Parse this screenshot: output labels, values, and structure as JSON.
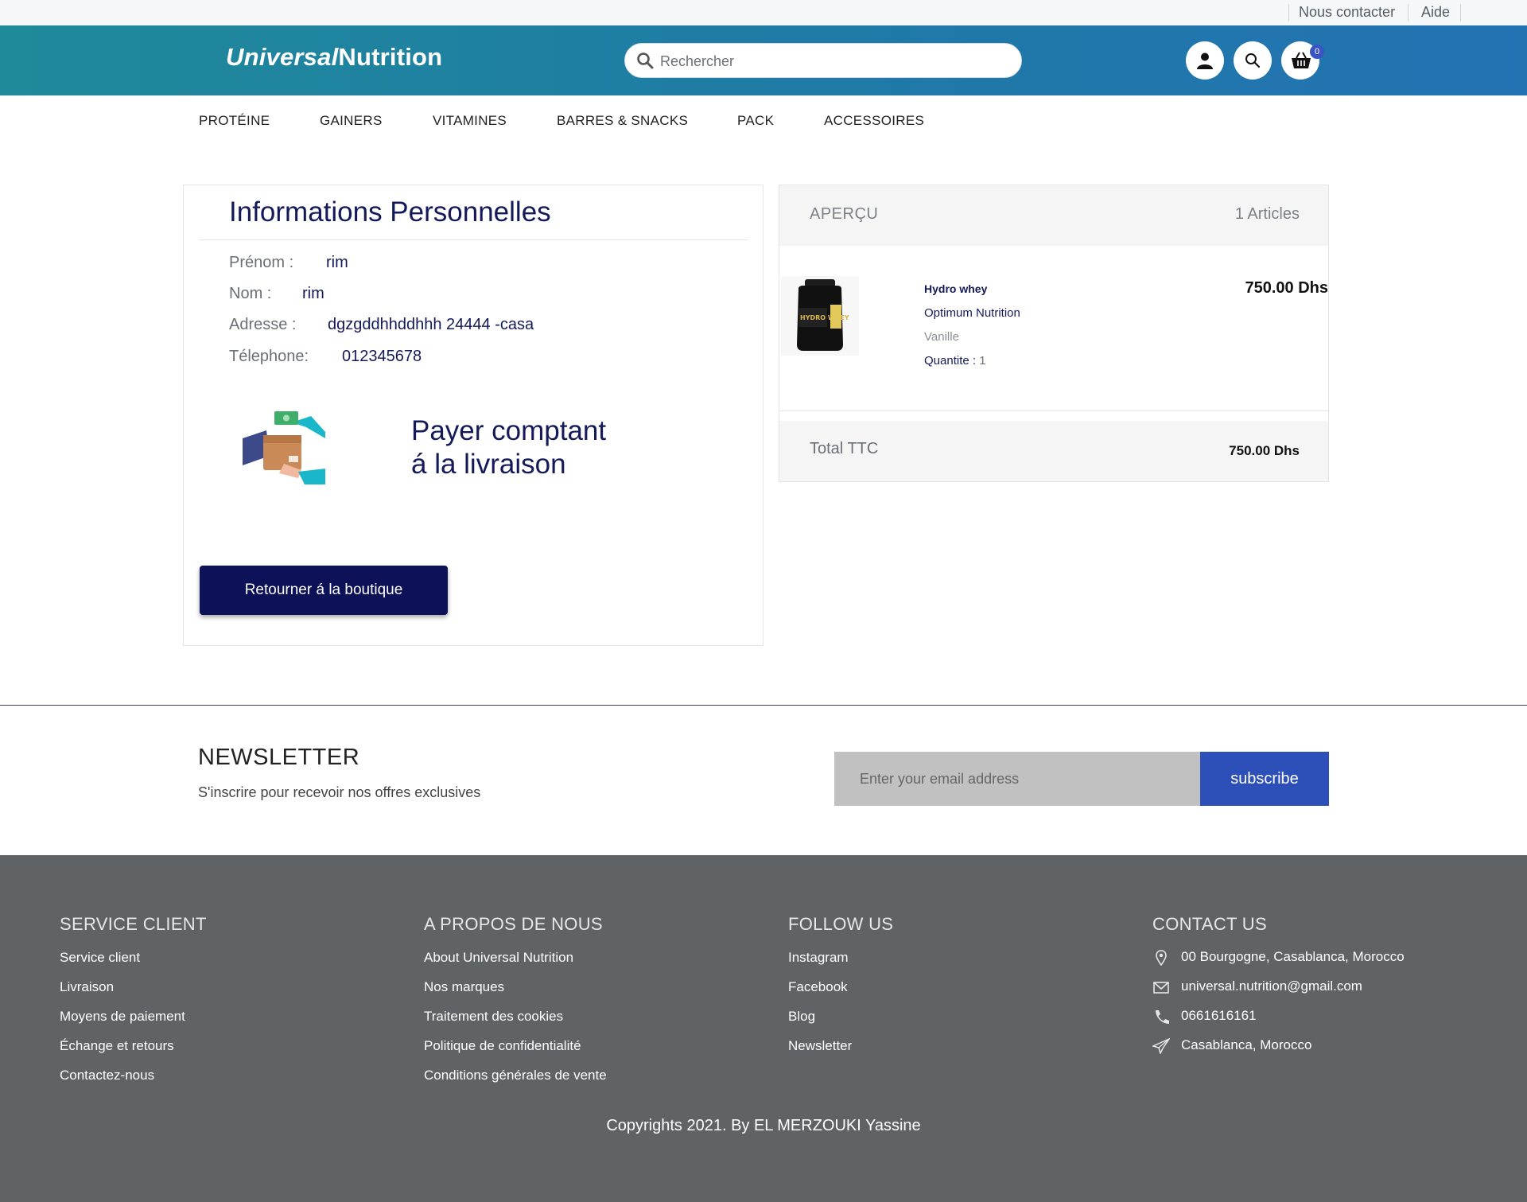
{
  "topbar": {
    "contact": "Nous contacter",
    "help": "Aide"
  },
  "header": {
    "logo_italic": "Universal",
    "logo_rest": "Nutrition",
    "search_placeholder": "Rechercher",
    "cart_count": "0"
  },
  "nav": {
    "items": [
      "PROTÉINE",
      "GAINERS",
      "VITAMINES",
      "BARRES & SNACKS",
      "PACK",
      "ACCESSOIRES"
    ]
  },
  "personal": {
    "title": "Informations Personnelles",
    "firstname_label": "Prénom :",
    "firstname": "rim",
    "lastname_label": "Nom :",
    "lastname": "rim",
    "address_label": "Adresse :",
    "address": "dgzgddhhddhhh 24444 -casa",
    "phone_label": "Télephone:",
    "phone": "012345678",
    "payment_text": "Payer comptant á la livraison",
    "back_button": "Retourner á la boutique"
  },
  "overview": {
    "title": "APERÇU",
    "count": "1 Articles",
    "product": {
      "name": "Hydro whey",
      "brand": "Optimum Nutrition",
      "flavor": "Vanille",
      "qty_label": "Quantite :",
      "qty": "1",
      "price": "750.00 Dhs",
      "image_label": "HYDRO WHEY"
    },
    "total_label": "Total TTC",
    "total_value": "750.00 Dhs"
  },
  "newsletter": {
    "title": "NEWSLETTER",
    "subtitle": "S'inscrire pour recevoir nos offres exclusives",
    "placeholder": "Enter your email address",
    "button": "subscribe"
  },
  "footer": {
    "service": {
      "title": "SERVICE CLIENT",
      "links": [
        "Service client",
        "Livraison",
        "Moyens de paiement",
        "Échange et retours",
        "Contactez-nous"
      ]
    },
    "about": {
      "title": "A PROPOS DE NOUS",
      "links": [
        "About Universal Nutrition",
        "Nos marques",
        "Traitement des cookies",
        "Politique de confidentialité",
        "Conditions générales de vente"
      ]
    },
    "follow": {
      "title": "FOLLOW US",
      "links": [
        "Instagram",
        "Facebook",
        "Blog",
        "Newsletter"
      ]
    },
    "contact": {
      "title": "CONTACT US",
      "address": "00 Bourgogne, Casablanca, Morocco",
      "email": "universal.nutrition@gmail.com",
      "phone": "0661616161",
      "city": "Casablanca, Morocco"
    },
    "copyright": "Copyrights 2021. By EL MERZOUKI Yassine"
  },
  "icons": {
    "search": "search-icon",
    "user": "user-icon",
    "cart": "basket-icon",
    "location": "map-pin-icon",
    "email": "envelope-icon",
    "phone": "phone-icon",
    "send": "paper-plane-icon"
  },
  "colors": {
    "header_start": "#1f8a9a",
    "header_end": "#2372b3",
    "navy": "#14195a",
    "button_navy": "#0c1158",
    "subscribe_blue": "#2d4fb8",
    "footer_bg": "#5f6366"
  }
}
